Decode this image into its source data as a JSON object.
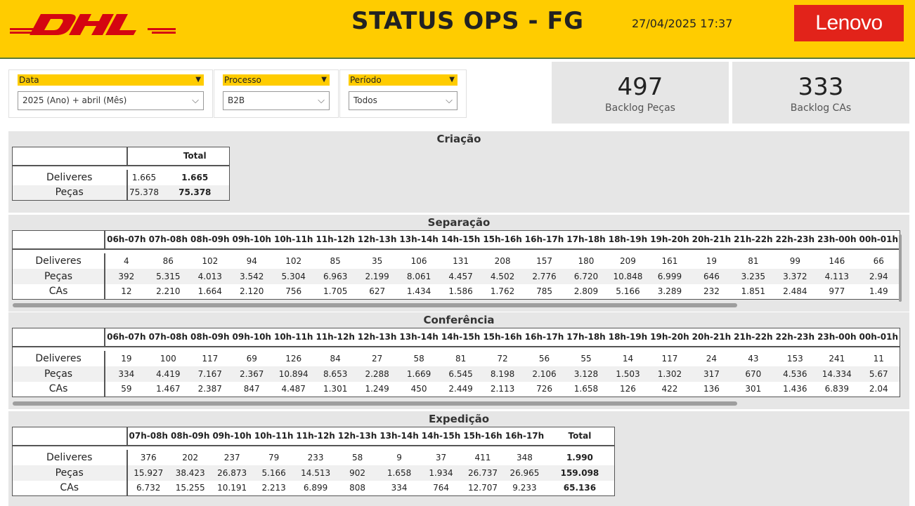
{
  "header": {
    "logo_left": "DHL",
    "title": "STATUS OPS - FG",
    "datetime": "27/04/2025 17:37",
    "logo_right": "Lenovo"
  },
  "colors": {
    "brand_yellow": "#ffcc00",
    "dhl_red": "#d40511",
    "lenovo_red": "#e2231a"
  },
  "filters": [
    {
      "label": "Data",
      "value": "2025 (Ano) + abril (Mês)"
    },
    {
      "label": "Processo",
      "value": "B2B"
    },
    {
      "label": "Período",
      "value": "Todos"
    }
  ],
  "cards": [
    {
      "value": "497",
      "label": "Backlog Peças"
    },
    {
      "value": "333",
      "label": "Backlog CAs"
    }
  ],
  "criacao": {
    "title": "Criação",
    "total_header": "Total",
    "rows": [
      {
        "label": "Deliveres",
        "value": "1.665",
        "total": "1.665"
      },
      {
        "label": "Peças",
        "value": "75.378",
        "total": "75.378"
      }
    ]
  },
  "separacao": {
    "title": "Separação",
    "columns": [
      "06h-07h",
      "07h-08h",
      "08h-09h",
      "09h-10h",
      "10h-11h",
      "11h-12h",
      "12h-13h",
      "13h-14h",
      "14h-15h",
      "15h-16h",
      "16h-17h",
      "17h-18h",
      "18h-19h",
      "19h-20h",
      "20h-21h",
      "21h-22h",
      "22h-23h",
      "23h-00h",
      "00h-01h"
    ],
    "rows": [
      {
        "label": "Deliveres",
        "values": [
          "4",
          "86",
          "102",
          "94",
          "102",
          "85",
          "35",
          "106",
          "131",
          "208",
          "157",
          "180",
          "209",
          "161",
          "19",
          "81",
          "99",
          "146",
          "66"
        ]
      },
      {
        "label": "Peças",
        "values": [
          "392",
          "5.315",
          "4.013",
          "3.542",
          "5.304",
          "6.963",
          "2.199",
          "8.061",
          "4.457",
          "4.502",
          "2.776",
          "6.720",
          "10.848",
          "6.999",
          "646",
          "3.235",
          "3.372",
          "4.113",
          "2.94"
        ]
      },
      {
        "label": "CAs",
        "values": [
          "12",
          "2.210",
          "1.664",
          "2.120",
          "756",
          "1.705",
          "627",
          "1.434",
          "1.586",
          "1.762",
          "785",
          "2.809",
          "5.166",
          "3.289",
          "232",
          "1.851",
          "2.484",
          "977",
          "1.49"
        ]
      }
    ]
  },
  "conferencia": {
    "title": "Conferência",
    "columns": [
      "06h-07h",
      "07h-08h",
      "08h-09h",
      "09h-10h",
      "10h-11h",
      "11h-12h",
      "12h-13h",
      "13h-14h",
      "14h-15h",
      "15h-16h",
      "16h-17h",
      "17h-18h",
      "18h-19h",
      "19h-20h",
      "20h-21h",
      "21h-22h",
      "22h-23h",
      "23h-00h",
      "00h-01h"
    ],
    "rows": [
      {
        "label": "Deliveres",
        "values": [
          "19",
          "100",
          "117",
          "69",
          "126",
          "84",
          "27",
          "58",
          "81",
          "72",
          "56",
          "55",
          "14",
          "117",
          "24",
          "43",
          "153",
          "241",
          "11"
        ]
      },
      {
        "label": "Peças",
        "values": [
          "334",
          "4.419",
          "7.167",
          "2.367",
          "10.894",
          "8.653",
          "2.288",
          "1.669",
          "6.545",
          "8.198",
          "2.106",
          "3.128",
          "1.503",
          "1.302",
          "317",
          "670",
          "4.536",
          "14.334",
          "5.67"
        ]
      },
      {
        "label": "CAs",
        "values": [
          "59",
          "1.467",
          "2.387",
          "847",
          "4.487",
          "1.301",
          "1.249",
          "450",
          "2.449",
          "2.113",
          "726",
          "1.658",
          "126",
          "422",
          "136",
          "301",
          "1.436",
          "6.839",
          "2.04"
        ]
      }
    ]
  },
  "expedicao": {
    "title": "Expedição",
    "columns": [
      "07h-08h",
      "08h-09h",
      "09h-10h",
      "10h-11h",
      "11h-12h",
      "12h-13h",
      "13h-14h",
      "14h-15h",
      "15h-16h",
      "16h-17h",
      "Total"
    ],
    "rows": [
      {
        "label": "Deliveres",
        "values": [
          "376",
          "202",
          "237",
          "79",
          "233",
          "58",
          "9",
          "37",
          "411",
          "348",
          "1.990"
        ]
      },
      {
        "label": "Peças",
        "values": [
          "15.927",
          "38.423",
          "26.873",
          "5.166",
          "14.513",
          "902",
          "1.658",
          "1.934",
          "26.737",
          "26.965",
          "159.098"
        ]
      },
      {
        "label": "CAs",
        "values": [
          "6.732",
          "15.255",
          "10.191",
          "2.213",
          "6.899",
          "808",
          "334",
          "764",
          "12.707",
          "9.233",
          "65.136"
        ]
      }
    ]
  }
}
